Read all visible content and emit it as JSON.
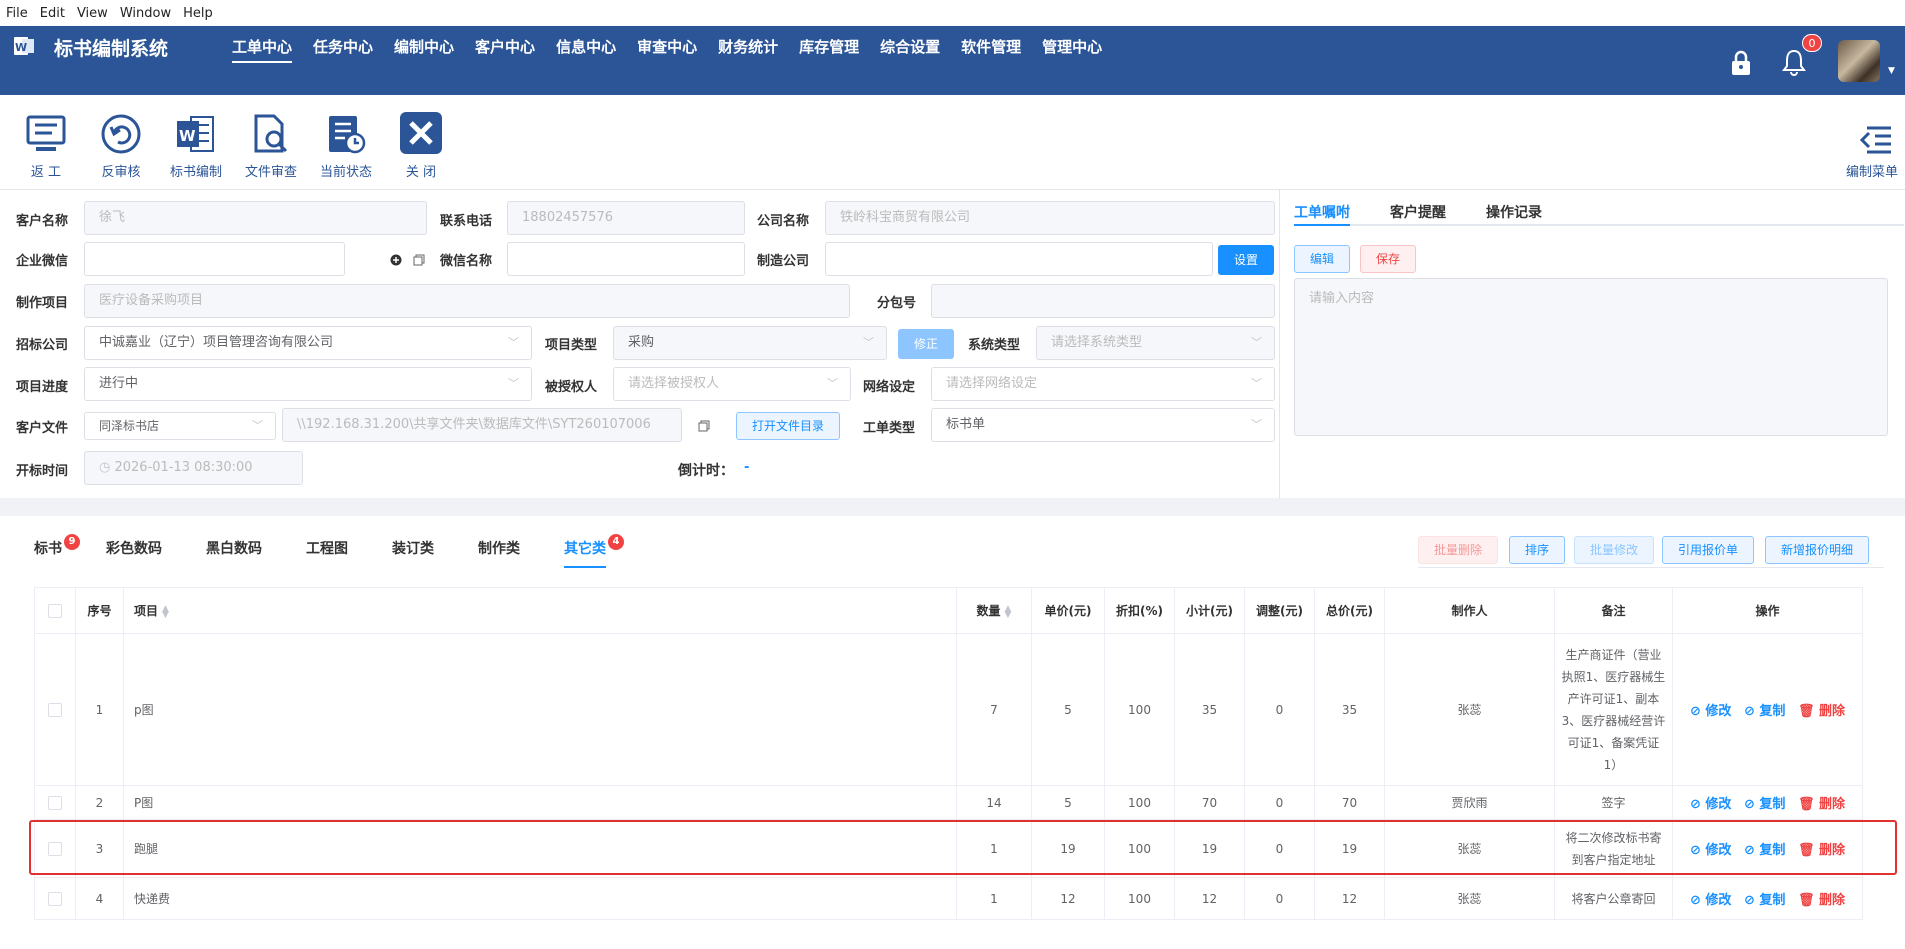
{
  "menubar": {
    "file": "File",
    "edit": "Edit",
    "view": "View",
    "window": "Window",
    "help": "Help"
  },
  "header": {
    "app_title": "标书编制系统",
    "nav": [
      "工单中心",
      "任务中心",
      "编制中心",
      "客户中心",
      "信息中心",
      "审查中心",
      "财务统计",
      "库存管理",
      "综合设置",
      "软件管理",
      "管理中心"
    ],
    "notification_count": "0"
  },
  "toolbar": {
    "return": "返 工",
    "reverse_review": "反审核",
    "bid_compile": "标书编制",
    "doc_review": "文件审查",
    "current_status": "当前状态",
    "close": "关 闭",
    "edit_menu": "编制菜单"
  },
  "form": {
    "customer_name_label": "客户名称",
    "customer_name": "徐飞",
    "phone_label": "联系电话",
    "phone": "18802457576",
    "company_label": "公司名称",
    "company": "铁岭科宝商贸有限公司",
    "wechat_corp_label": "企业微信",
    "wechat_name_label": "微信名称",
    "manufacturer_label": "制造公司",
    "set_button": "设置",
    "project_label": "制作项目",
    "project": "医疗设备采购项目",
    "subpackage_label": "分包号",
    "tender_company_label": "招标公司",
    "tender_company": "中诚嘉业（辽宁）项目管理咨询有限公司",
    "project_type_label": "项目类型",
    "project_type": "采购",
    "fix_button": "修正",
    "system_type_label": "系统类型",
    "system_type_placeholder": "请选择系统类型",
    "progress_label": "项目进度",
    "progress": "进行中",
    "authorized_label": "被授权人",
    "authorized_placeholder": "请选择被授权人",
    "network_label": "网络设定",
    "network_placeholder": "请选择网络设定",
    "customer_file_label": "客户文件",
    "customer_file_select": "同泽标书店",
    "file_path": "\\\\192.168.31.200\\共享文件夹\\数据库文件\\SYT260107006",
    "open_dir_button": "打开文件目录",
    "order_type_label": "工单类型",
    "order_type": "标书单",
    "open_time_label": "开标时间",
    "open_time": "2026-01-13 08:30:00",
    "countdown_label": "倒计时：",
    "countdown": "-"
  },
  "right_panel": {
    "tabs": [
      "工单嘱咐",
      "客户提醒",
      "操作记录"
    ],
    "edit_button": "编辑",
    "save_button": "保存",
    "textarea_placeholder": "请输入内容"
  },
  "bottom_tabs": [
    {
      "label": "标书",
      "badge": "9"
    },
    {
      "label": "彩色数码",
      "badge": ""
    },
    {
      "label": "黑白数码",
      "badge": ""
    },
    {
      "label": "工程图",
      "badge": ""
    },
    {
      "label": "装订类",
      "badge": ""
    },
    {
      "label": "制作类",
      "badge": ""
    },
    {
      "label": "其它类",
      "badge": "4"
    }
  ],
  "action_buttons": {
    "batch_delete": "批量删除",
    "sort": "排序",
    "batch_edit": "批量修改",
    "quote_ref": "引用报价单",
    "add_quote": "新增报价明细"
  },
  "table": {
    "headers": [
      "序号",
      "项目",
      "数量",
      "单价(元)",
      "折扣(%)",
      "小计(元)",
      "调整(元)",
      "总价(元)",
      "制作人",
      "备注",
      "操作"
    ],
    "ops": {
      "edit": "修改",
      "copy": "复制",
      "delete": "删除"
    },
    "rows": [
      {
        "no": "1",
        "item": "p图",
        "qty": "7",
        "price": "5",
        "discount": "100",
        "subtotal": "35",
        "adjust": "0",
        "total": "35",
        "maker": "张蕊",
        "note": "生产商证件（营业执照1、医疗器械生产许可证1、副本3、医疗器械经营许可证1、备案凭证1）"
      },
      {
        "no": "2",
        "item": "P图",
        "qty": "14",
        "price": "5",
        "discount": "100",
        "subtotal": "70",
        "adjust": "0",
        "total": "70",
        "maker": "贾欣雨",
        "note": "签字"
      },
      {
        "no": "3",
        "item": "跑腿",
        "qty": "1",
        "price": "19",
        "discount": "100",
        "subtotal": "19",
        "adjust": "0",
        "total": "19",
        "maker": "张蕊",
        "note": "将二次修改标书寄到客户指定地址"
      },
      {
        "no": "4",
        "item": "快递费",
        "qty": "1",
        "price": "12",
        "discount": "100",
        "subtotal": "12",
        "adjust": "0",
        "total": "12",
        "maker": "张蕊",
        "note": "将客户公章寄回"
      }
    ]
  },
  "colors": {
    "header_bg": "#2b5597",
    "accent": "#1890ff",
    "danger": "#f04444",
    "highlight_border": "#e03030"
  }
}
